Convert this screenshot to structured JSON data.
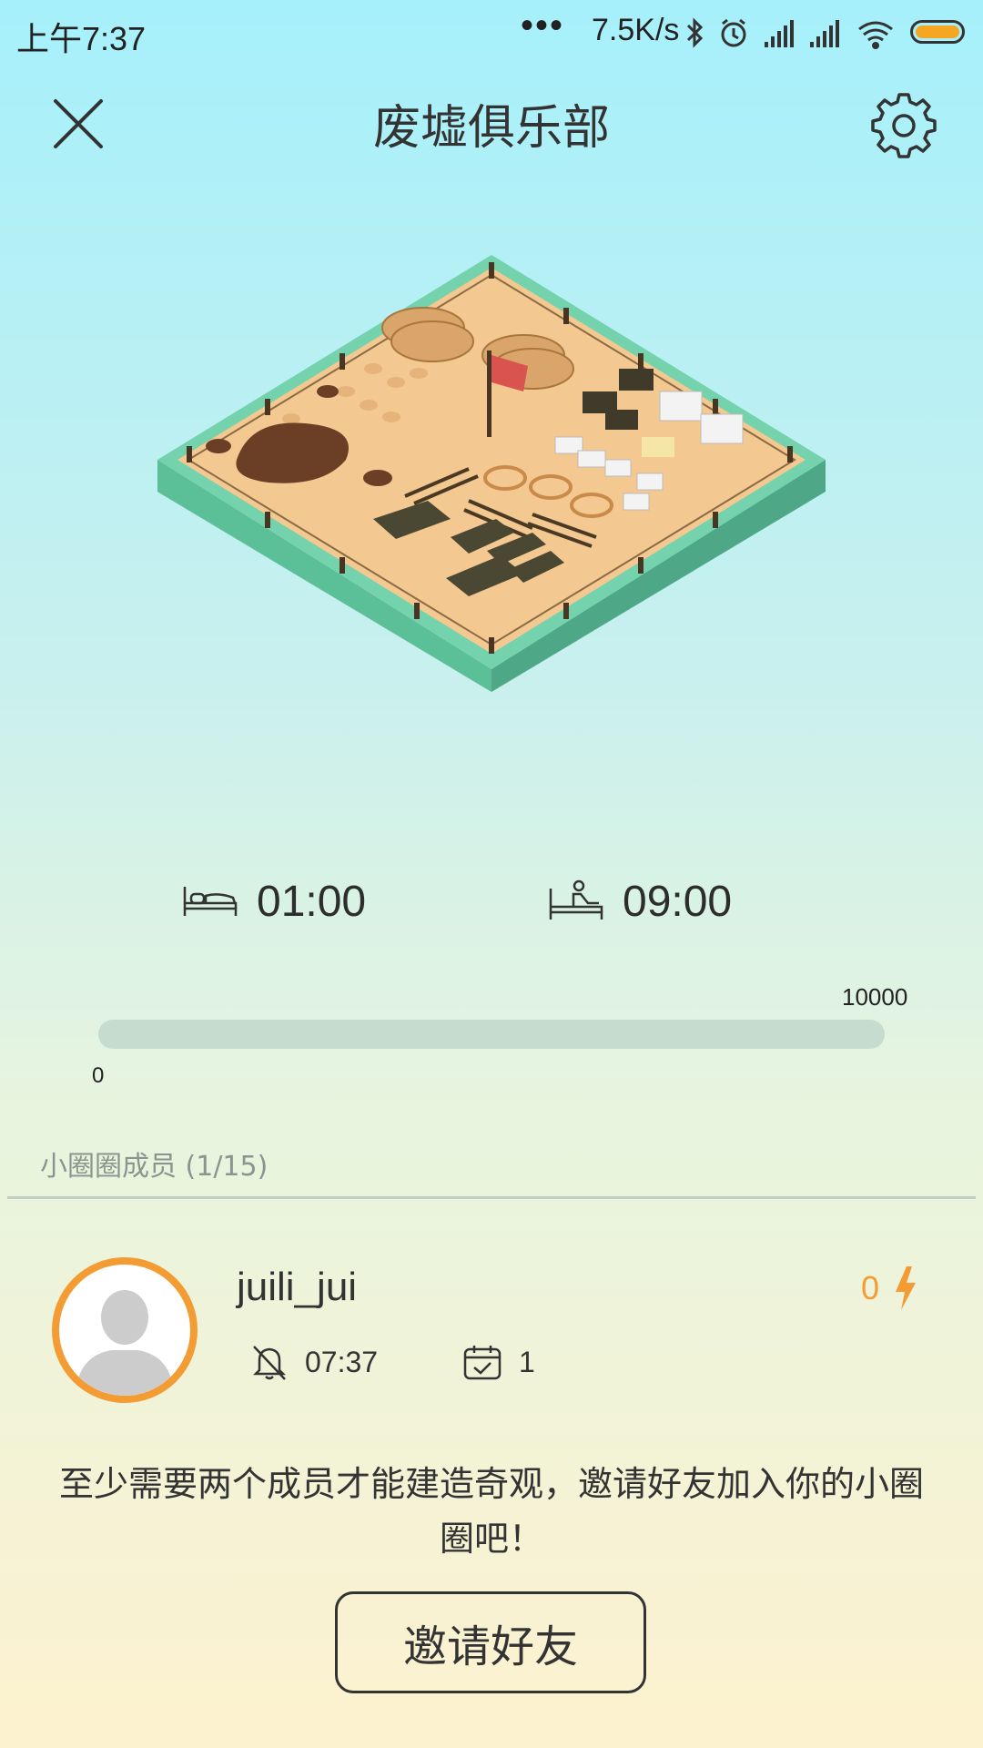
{
  "status_bar": {
    "time": "上午7:37",
    "more": "•••",
    "net_speed": "7.5K/s",
    "icons": [
      "bluetooth-icon",
      "alarm-icon",
      "signal-icon",
      "signal-icon",
      "wifi-icon",
      "battery-icon"
    ]
  },
  "header": {
    "title": "废墟俱乐部",
    "close_icon": "close-icon",
    "settings_icon": "gear-icon"
  },
  "schedule": {
    "sleep_time": "01:00",
    "wake_time": "09:00"
  },
  "progress": {
    "min_label": "0",
    "max_label": "10000",
    "value": 0
  },
  "members": {
    "heading": "小圈圈成员 (1/15)",
    "list": [
      {
        "name": "juili_jui",
        "alarm_time": "07:37",
        "days": "1",
        "energy": "0"
      }
    ]
  },
  "notice": "至少需要两个成员才能建造奇观，邀请好友加入你的小圈圈吧！",
  "invite_button": "邀请好友",
  "colors": {
    "accent": "#f39c33",
    "track": "#c5dccf",
    "text": "#333333"
  }
}
